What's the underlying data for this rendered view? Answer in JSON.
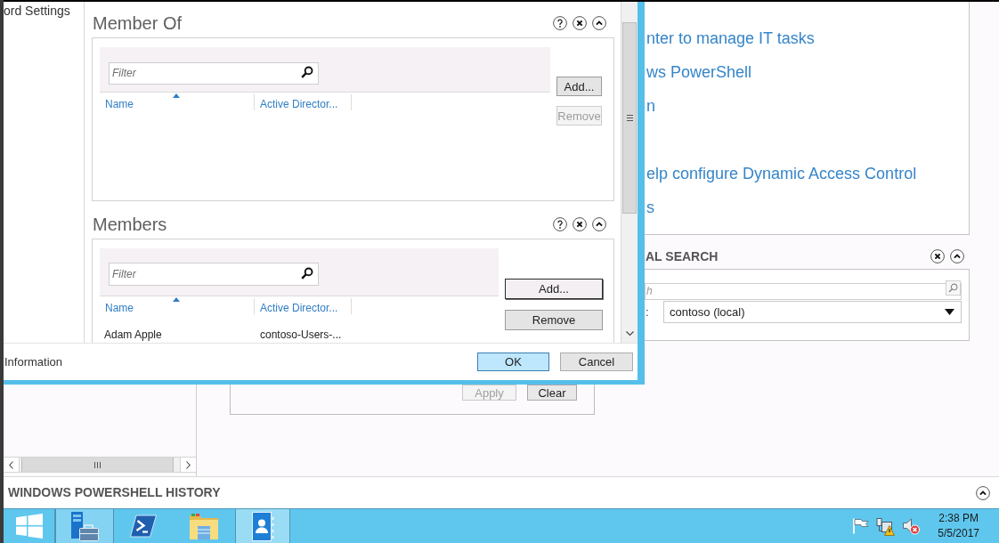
{
  "dialog": {
    "nav_item": "ord Settings",
    "sections": [
      {
        "title": "Member Of",
        "filter": {
          "placeholder": "Filter"
        },
        "columns": [
          {
            "label": "Name",
            "sorted": true
          },
          {
            "label": "Active Director...",
            "sorted": false
          }
        ],
        "buttons": [
          {
            "label": "Add...",
            "disabled": false,
            "focused": false
          },
          {
            "label": "Remove",
            "disabled": true,
            "focused": false
          }
        ]
      },
      {
        "title": "Members",
        "filter": {
          "placeholder": "Filter"
        },
        "columns": [
          {
            "label": "Name",
            "sorted": true
          },
          {
            "label": "Active Director...",
            "sorted": false
          }
        ],
        "rows": [
          {
            "cells": [
              "Adam Apple",
              "contoso-Users-..."
            ]
          }
        ],
        "buttons": [
          {
            "label": "Add...",
            "disabled": false,
            "focused": true
          },
          {
            "label": "Remove",
            "disabled": false,
            "focused": false
          }
        ]
      }
    ],
    "footer": {
      "link": "Information",
      "buttons": [
        {
          "label": "OK",
          "default": true
        },
        {
          "label": "Cancel",
          "default": false
        }
      ]
    }
  },
  "background": {
    "welcome_links": [
      "nter to manage IT tasks",
      "ws PowerShell",
      "n",
      "elp configure Dynamic Access Control",
      "s"
    ],
    "global_search": {
      "title": "AL SEARCH",
      "search": {
        "placeholder": "h"
      },
      "scope_label": ":",
      "scope": {
        "value": "contoso (local)"
      }
    },
    "filter_panel": {
      "buttons": [
        {
          "label": "Apply",
          "disabled": true
        },
        {
          "label": "Clear",
          "disabled": false
        }
      ]
    },
    "powershell_history": {
      "title": "WINDOWS POWERSHELL HISTORY"
    }
  },
  "taskbar": {
    "apps": [
      {
        "kind": "start",
        "running": false,
        "active": false
      },
      {
        "kind": "server-manager",
        "running": true,
        "active": false
      },
      {
        "kind": "powershell",
        "running": false,
        "active": false
      },
      {
        "kind": "explorer",
        "running": false,
        "active": false
      },
      {
        "kind": "directory-center",
        "running": true,
        "active": true
      }
    ],
    "clock": {
      "time": "2:38 PM",
      "date": "5/5/2017"
    }
  }
}
